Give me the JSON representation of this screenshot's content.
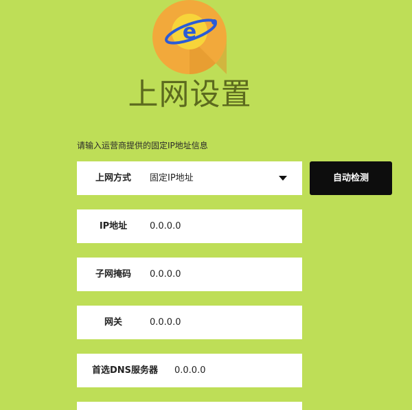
{
  "header": {
    "title": "上网设置"
  },
  "instruction": "请输入运营商提供的固定IP地址信息",
  "form": {
    "connection_type": {
      "label": "上网方式",
      "value": "固定IP地址"
    },
    "ip_address": {
      "label": "IP地址",
      "value": "0.0.0.0"
    },
    "subnet_mask": {
      "label": "子网掩码",
      "value": "0.0.0.0"
    },
    "gateway": {
      "label": "网关",
      "value": "0.0.0.0"
    },
    "primary_dns": {
      "label": "首选DNS服务器",
      "value": "0.0.0.0"
    }
  },
  "buttons": {
    "auto_detect": "自动检测"
  },
  "icons": {
    "logo": "internet-globe-e-icon",
    "dropdown": "caret-down-icon"
  },
  "colors": {
    "background": "#bede57",
    "title": "#5c6a1e",
    "button": "#0d0d0d",
    "logo_orange": "#f2a93b",
    "logo_yellow": "#f7d43a",
    "logo_ring": "#2a5bd7"
  }
}
